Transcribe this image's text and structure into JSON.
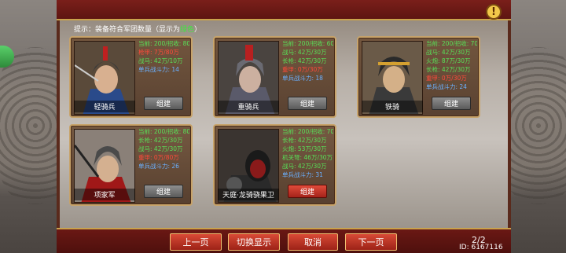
{
  "hint": {
    "prefix": "提示：装备符合军团数量（显示为",
    "green": "绿色",
    "suffix": "）"
  },
  "units": [
    {
      "name": "轻骑兵",
      "build": "组建",
      "lines": [
        {
          "t": "当前: 200/招收: 80",
          "c": "g"
        },
        {
          "t": "枪甲: 7万/80万",
          "c": "r"
        },
        {
          "t": "战马: 42万/10万",
          "c": "g"
        },
        {
          "t": "单兵战斗力: 14",
          "c": "b"
        }
      ]
    },
    {
      "name": "重骑兵",
      "build": "组建",
      "lines": [
        {
          "t": "当前: 200/招收: 60",
          "c": "g"
        },
        {
          "t": "战马: 42万/30万",
          "c": "g"
        },
        {
          "t": "长枪: 42万/30万",
          "c": "g"
        },
        {
          "t": "重甲: 0万/30万",
          "c": "r"
        },
        {
          "t": "单兵战斗力: 18",
          "c": "b"
        }
      ]
    },
    {
      "name": "铁骑",
      "build": "组建",
      "lines": [
        {
          "t": "当前: 200/招收: 70",
          "c": "g"
        },
        {
          "t": "战马: 42万/30万",
          "c": "g"
        },
        {
          "t": "火炮: 87万/30万",
          "c": "g"
        },
        {
          "t": "长枪: 42万/30万",
          "c": "g"
        },
        {
          "t": "重甲: 0万/30万",
          "c": "r"
        },
        {
          "t": "单兵战斗力: 24",
          "c": "b"
        }
      ]
    },
    {
      "name": "项家军",
      "build": "组建",
      "lines": [
        {
          "t": "当前: 200/招收: 80",
          "c": "g"
        },
        {
          "t": "长枪: 42万/30万",
          "c": "g"
        },
        {
          "t": "战马: 42万/30万",
          "c": "g"
        },
        {
          "t": "重甲: 0万/80万",
          "c": "r"
        },
        {
          "t": "单兵战斗力: 26",
          "c": "b"
        }
      ]
    },
    {
      "name": "天庭·龙骑骁果卫",
      "build": "组建",
      "lines": [
        {
          "t": "当前: 200/招收: 70",
          "c": "g"
        },
        {
          "t": "长枪: 42万/30万",
          "c": "g"
        },
        {
          "t": "火炮: 53万/30万",
          "c": "g"
        },
        {
          "t": "机关弩: 46万/30万",
          "c": "g"
        },
        {
          "t": "战马: 42万/30万",
          "c": "g"
        },
        {
          "t": "单兵战斗力: 31",
          "c": "b"
        }
      ]
    }
  ],
  "nav": {
    "prev": "上一页",
    "switch": "切换显示",
    "cancel": "取消",
    "next": "下一页"
  },
  "page": "2/2",
  "uid": "ID: 6167116"
}
